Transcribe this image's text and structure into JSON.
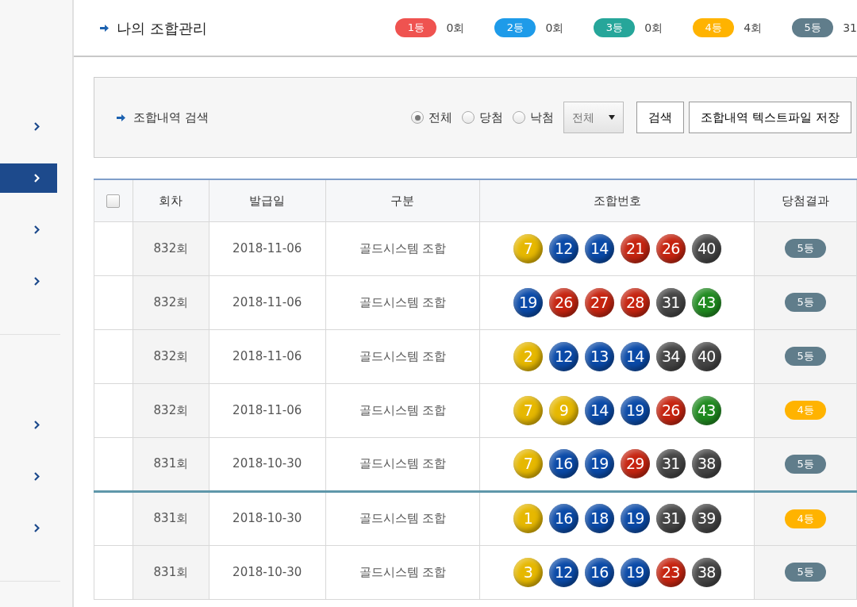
{
  "sidebar": {
    "groups": [
      {
        "items": [
          {
            "selected": false
          },
          {
            "selected": true
          },
          {
            "selected": false
          },
          {
            "selected": false
          }
        ]
      },
      {
        "items": [
          {
            "selected": false
          },
          {
            "selected": false
          },
          {
            "selected": false
          }
        ]
      }
    ]
  },
  "header": {
    "title": "나의 조합관리",
    "ranks": [
      {
        "label": "1등",
        "count": "0회",
        "color": "#ef5350"
      },
      {
        "label": "2등",
        "count": "0회",
        "color": "#1e9be9"
      },
      {
        "label": "3등",
        "count": "0회",
        "color": "#26a69a"
      },
      {
        "label": "4등",
        "count": "4회",
        "color": "#ffb300"
      },
      {
        "label": "5등",
        "count": "31",
        "color": "#607d8b"
      }
    ]
  },
  "search": {
    "label": "조합내역 검색",
    "radios": [
      {
        "label": "전체",
        "selected": true
      },
      {
        "label": "당첨",
        "selected": false
      },
      {
        "label": "낙첨",
        "selected": false
      }
    ],
    "select": "전체",
    "buttons": [
      "검색",
      "조합내역 텍스트파일 저장"
    ]
  },
  "table": {
    "select_all_checked": false,
    "columns": [
      "회차",
      "발급일",
      "구분",
      "조합번호",
      "당첨결과"
    ],
    "rows": [
      {
        "divider_before": false,
        "round": "832회",
        "date": "2018-11-06",
        "type": "골드시스템 조합",
        "balls": [
          {
            "value": "7",
            "color": "#e6b800"
          },
          {
            "value": "12",
            "color": "#0a4aa8"
          },
          {
            "value": "14",
            "color": "#0a4aa8"
          },
          {
            "value": "21",
            "color": "#c62410"
          },
          {
            "value": "26",
            "color": "#c62410"
          },
          {
            "value": "40",
            "color": "#444444"
          }
        ],
        "result": {
          "label": "5등",
          "color": "#607d8b"
        }
      },
      {
        "divider_before": false,
        "round": "832회",
        "date": "2018-11-06",
        "type": "골드시스템 조합",
        "balls": [
          {
            "value": "19",
            "color": "#0a4aa8"
          },
          {
            "value": "26",
            "color": "#c62410"
          },
          {
            "value": "27",
            "color": "#c62410"
          },
          {
            "value": "28",
            "color": "#c62410"
          },
          {
            "value": "31",
            "color": "#444444"
          },
          {
            "value": "43",
            "color": "#1f8a1f"
          }
        ],
        "result": {
          "label": "5등",
          "color": "#607d8b"
        }
      },
      {
        "divider_before": false,
        "round": "832회",
        "date": "2018-11-06",
        "type": "골드시스템 조합",
        "balls": [
          {
            "value": "2",
            "color": "#e6b800"
          },
          {
            "value": "12",
            "color": "#0a4aa8"
          },
          {
            "value": "13",
            "color": "#0a4aa8"
          },
          {
            "value": "14",
            "color": "#0a4aa8"
          },
          {
            "value": "34",
            "color": "#444444"
          },
          {
            "value": "40",
            "color": "#444444"
          }
        ],
        "result": {
          "label": "5등",
          "color": "#607d8b"
        }
      },
      {
        "divider_before": false,
        "round": "832회",
        "date": "2018-11-06",
        "type": "골드시스템 조합",
        "balls": [
          {
            "value": "7",
            "color": "#e6b800"
          },
          {
            "value": "9",
            "color": "#e6b800"
          },
          {
            "value": "14",
            "color": "#0a4aa8"
          },
          {
            "value": "19",
            "color": "#0a4aa8"
          },
          {
            "value": "26",
            "color": "#c62410"
          },
          {
            "value": "43",
            "color": "#1f8a1f"
          }
        ],
        "result": {
          "label": "4등",
          "color": "#ffb300"
        }
      },
      {
        "divider_before": false,
        "round": "831회",
        "date": "2018-10-30",
        "type": "골드시스템 조합",
        "balls": [
          {
            "value": "7",
            "color": "#e6b800"
          },
          {
            "value": "16",
            "color": "#0a4aa8"
          },
          {
            "value": "19",
            "color": "#0a4aa8"
          },
          {
            "value": "29",
            "color": "#c62410"
          },
          {
            "value": "31",
            "color": "#444444"
          },
          {
            "value": "38",
            "color": "#444444"
          }
        ],
        "result": {
          "label": "5등",
          "color": "#607d8b"
        }
      },
      {
        "divider_before": true,
        "round": "831회",
        "date": "2018-10-30",
        "type": "골드시스템 조합",
        "balls": [
          {
            "value": "1",
            "color": "#e6b800"
          },
          {
            "value": "16",
            "color": "#0a4aa8"
          },
          {
            "value": "18",
            "color": "#0a4aa8"
          },
          {
            "value": "19",
            "color": "#0a4aa8"
          },
          {
            "value": "31",
            "color": "#444444"
          },
          {
            "value": "39",
            "color": "#444444"
          }
        ],
        "result": {
          "label": "4등",
          "color": "#ffb300"
        }
      },
      {
        "divider_before": false,
        "round": "831회",
        "date": "2018-10-30",
        "type": "골드시스템 조합",
        "balls": [
          {
            "value": "3",
            "color": "#e6b800"
          },
          {
            "value": "12",
            "color": "#0a4aa8"
          },
          {
            "value": "16",
            "color": "#0a4aa8"
          },
          {
            "value": "19",
            "color": "#0a4aa8"
          },
          {
            "value": "23",
            "color": "#c62410"
          },
          {
            "value": "38",
            "color": "#444444"
          }
        ],
        "result": {
          "label": "5등",
          "color": "#607d8b"
        }
      }
    ]
  }
}
